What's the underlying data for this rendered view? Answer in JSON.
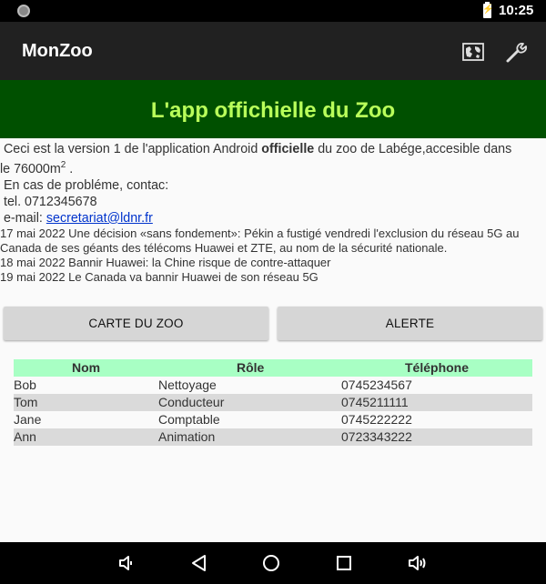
{
  "status_bar": {
    "time": "10:25"
  },
  "app_bar": {
    "title": "MonZoo"
  },
  "banner": {
    "text": "L'app offichielle du Zoo"
  },
  "intro": {
    "line1_pre": " Ceci est la version 1 de l'application Android ",
    "line1_bold": "officielle",
    "line1_post": " du zoo de Labége,accesible dans",
    "line2": "le 76000m",
    "line2_sup": "2",
    "line2_post": " .",
    "contact_heading": " En cas de probléme, contac:",
    "phone": " tel. 0712345678",
    "email_label": " e-mail: ",
    "email": "secretariat@ldnr.fr"
  },
  "news": [
    "17 mai 2022 Une décision «sans fondement»: Pékin a fustigé vendredi l'exclusion du réseau 5G au",
    "Canada de ses géants des télécoms Huawei et ZTE, au nom de la sécurité nationale.",
    "18 mai 2022 Bannir Huawei: la Chine risque de contre-attaquer",
    "19 mai 2022 Le Canada va bannir Huawei de son réseau 5G"
  ],
  "buttons": {
    "map": "CARTE DU ZOO",
    "alert": "ALERTE"
  },
  "table": {
    "headers": [
      "Nom",
      "Rôle",
      "Téléphone"
    ],
    "rows": [
      [
        "Bob",
        "Nettoyage",
        "0745234567"
      ],
      [
        "Tom",
        "Conducteur",
        "0745211111"
      ],
      [
        "Jane",
        "Comptable",
        "0745222222"
      ],
      [
        "Ann",
        "Animation",
        "0723343222"
      ]
    ]
  },
  "icons": {
    "status": "status-circle-icon",
    "battery": "battery-charging-icon",
    "map": "map-icon",
    "settings": "wrench-icon",
    "nav": [
      "volume-down-icon",
      "back-icon",
      "home-icon",
      "recents-icon",
      "volume-up-icon"
    ]
  },
  "colors": {
    "app_bar": "#212121",
    "banner_bg": "#005000",
    "banner_text": "#b9ff5a",
    "table_header": "#a8ffc4",
    "table_alt_row": "#dadada",
    "link": "#0033cc"
  }
}
